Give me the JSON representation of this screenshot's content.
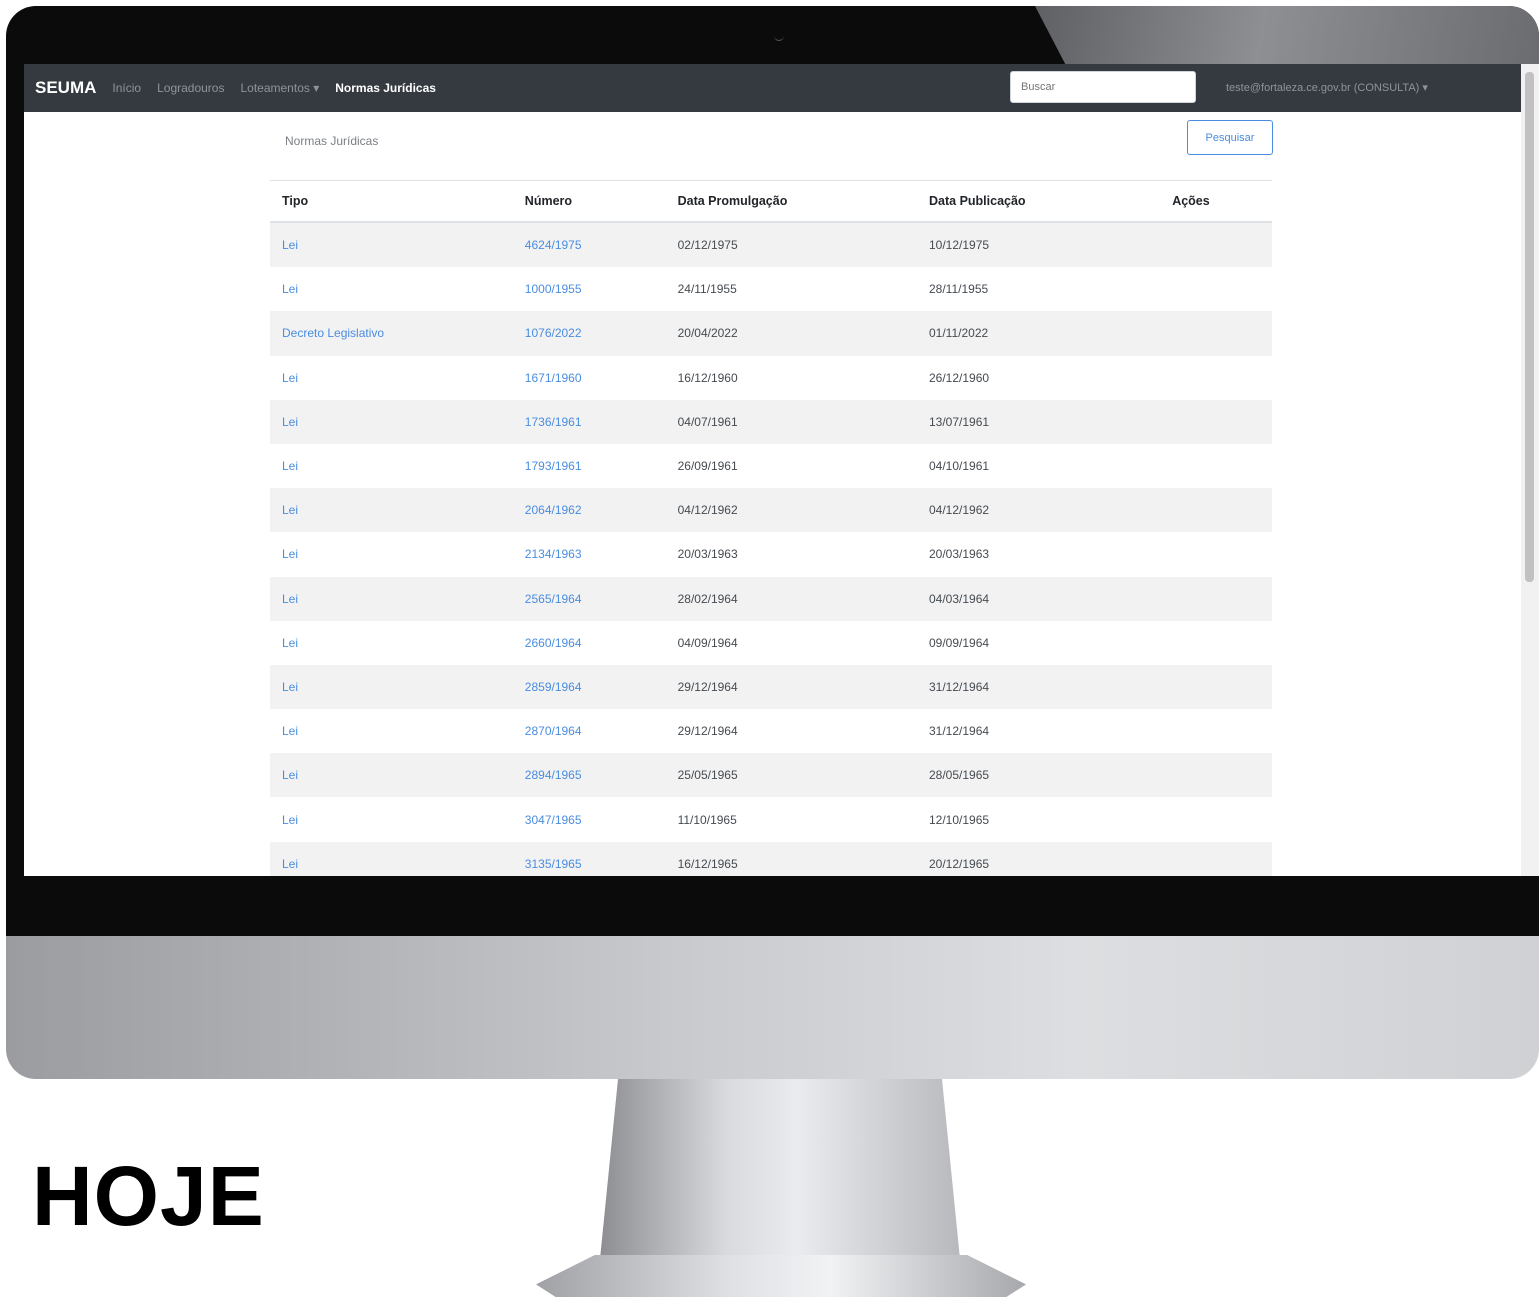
{
  "app": {
    "brand": "SEUMA",
    "nav": [
      "Início",
      "Logradouros",
      "Loteamentos ▾",
      "Normas Jurídicas"
    ],
    "search_placeholder": "Buscar",
    "user": "teste@fortaleza.ce.gov.br (CONSULTA) ▾"
  },
  "page": {
    "title": "Normas Jurídicas",
    "search_button": "Pesquisar"
  },
  "table": {
    "columns": [
      "Tipo",
      "Número",
      "Data Promulgação",
      "Data Publicação",
      "Ações"
    ],
    "rows": [
      {
        "tipo": "Lei",
        "numero": "4624/1975",
        "promulgacao": "02/12/1975",
        "publicacao": "10/12/1975"
      },
      {
        "tipo": "Lei",
        "numero": "1000/1955",
        "promulgacao": "24/11/1955",
        "publicacao": "28/11/1955"
      },
      {
        "tipo": "Decreto Legislativo",
        "numero": "1076/2022",
        "promulgacao": "20/04/2022",
        "publicacao": "01/11/2022"
      },
      {
        "tipo": "Lei",
        "numero": "1671/1960",
        "promulgacao": "16/12/1960",
        "publicacao": "26/12/1960"
      },
      {
        "tipo": "Lei",
        "numero": "1736/1961",
        "promulgacao": "04/07/1961",
        "publicacao": "13/07/1961"
      },
      {
        "tipo": "Lei",
        "numero": "1793/1961",
        "promulgacao": "26/09/1961",
        "publicacao": "04/10/1961"
      },
      {
        "tipo": "Lei",
        "numero": "2064/1962",
        "promulgacao": "04/12/1962",
        "publicacao": "04/12/1962"
      },
      {
        "tipo": "Lei",
        "numero": "2134/1963",
        "promulgacao": "20/03/1963",
        "publicacao": "20/03/1963"
      },
      {
        "tipo": "Lei",
        "numero": "2565/1964",
        "promulgacao": "28/02/1964",
        "publicacao": "04/03/1964"
      },
      {
        "tipo": "Lei",
        "numero": "2660/1964",
        "promulgacao": "04/09/1964",
        "publicacao": "09/09/1964"
      },
      {
        "tipo": "Lei",
        "numero": "2859/1964",
        "promulgacao": "29/12/1964",
        "publicacao": "31/12/1964"
      },
      {
        "tipo": "Lei",
        "numero": "2870/1964",
        "promulgacao": "29/12/1964",
        "publicacao": "31/12/1964"
      },
      {
        "tipo": "Lei",
        "numero": "2894/1965",
        "promulgacao": "25/05/1965",
        "publicacao": "28/05/1965"
      },
      {
        "tipo": "Lei",
        "numero": "3047/1965",
        "promulgacao": "11/10/1965",
        "publicacao": "12/10/1965"
      },
      {
        "tipo": "Lei",
        "numero": "3135/1965",
        "promulgacao": "16/12/1965",
        "publicacao": "20/12/1965"
      }
    ]
  },
  "caption": "HOJE"
}
